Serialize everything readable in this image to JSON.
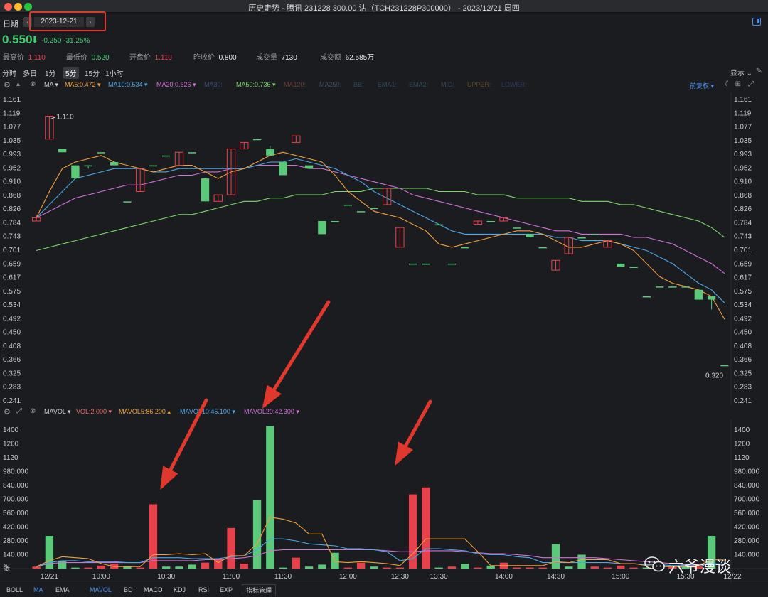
{
  "window": {
    "title": "历史走势 - 腾讯 231228 300.00 沽（TCH231228P300000） - 2023/12/21 周四"
  },
  "datebar": {
    "label": "日期",
    "prev": "‹",
    "date": "2023-12-21",
    "next": "›"
  },
  "quote": {
    "price": "0.550",
    "arrow": "⬇",
    "change": "-0.250 -31.25%"
  },
  "stats": [
    {
      "label": "最高价",
      "value": "1.110",
      "color": "#e8414b"
    },
    {
      "label": "最低价",
      "value": "0.520",
      "color": "#3fcf72"
    },
    {
      "label": "开盘价",
      "value": "1.110",
      "color": "#e8414b"
    },
    {
      "label": "昨收价",
      "value": "0.800",
      "color": "#e6e6e6"
    },
    {
      "label": "成交量",
      "value": "7130",
      "color": "#e6e6e6"
    },
    {
      "label": "成交额",
      "value": "62.585万",
      "color": "#e6e6e6"
    }
  ],
  "periods": [
    "分时",
    "多日",
    "1分",
    "5分",
    "15分",
    "1小时"
  ],
  "active_period": "5分",
  "display": "显示 ⌄",
  "main_indicators": {
    "name": "MA ▾",
    "items": [
      {
        "text": "MA5:0.472 ▾",
        "color": "#f0a03c"
      },
      {
        "text": "MA10:0.534 ▾",
        "color": "#4aa8e8"
      },
      {
        "text": "MA20:0.626 ▾",
        "color": "#d070d8"
      },
      {
        "text": "MA30:",
        "color": "#3a4e70"
      },
      {
        "text": "MA50:0.736 ▾",
        "color": "#7ad86a"
      },
      {
        "text": "MA120:",
        "color": "#6a3a3a"
      },
      {
        "text": "MA250:",
        "color": "#3a5060"
      },
      {
        "text": "BB:",
        "color": "#2e4a5a"
      },
      {
        "text": "EMA1:",
        "color": "#2e4a5a"
      },
      {
        "text": "EMA2:",
        "color": "#2e4a5a"
      },
      {
        "text": "MID:",
        "color": "#3a4a5a"
      },
      {
        "text": "UPPER:",
        "color": "#5a4a2a"
      },
      {
        "text": "LOWER:",
        "color": "#2a3a60"
      }
    ],
    "adjust": "前复权 ▾"
  },
  "vol_indicators": {
    "name": "MAVOL ▾",
    "items": [
      {
        "text": "VOL:2.000 ▾",
        "color": "#e86a6a"
      },
      {
        "text": "MAVOL5:86.200 ▴",
        "color": "#f0a03c"
      },
      {
        "text": "MAVOL10:45.100 ▾",
        "color": "#4aa8e8"
      },
      {
        "text": "MAVOL20:42.300 ▾",
        "color": "#d070d8"
      }
    ]
  },
  "price_axis": [
    "1.161",
    "1.119",
    "1.077",
    "1.035",
    "0.993",
    "0.952",
    "0.910",
    "0.868",
    "0.826",
    "0.784",
    "0.743",
    "0.701",
    "0.659",
    "0.617",
    "0.575",
    "0.534",
    "0.492",
    "0.450",
    "0.408",
    "0.366",
    "0.325",
    "0.283",
    "0.241"
  ],
  "vol_axis": [
    "1400",
    "1260",
    "1120",
    "980.000",
    "840.000",
    "700.000",
    "560.000",
    "420.000",
    "280.000",
    "140.000",
    "张"
  ],
  "vol_axis_right": [
    "1400",
    "1260",
    "1120",
    "980.000",
    "840.000",
    "700.000",
    "560.000",
    "420.000",
    "280.000",
    "140.000"
  ],
  "time_axis": [
    "12/21",
    "10:00",
    "10:30",
    "11:00",
    "11:30",
    "12:00",
    "12:30",
    "13:30",
    "14:00",
    "14:30",
    "15:00",
    "15:30",
    "12/22"
  ],
  "annotations": {
    "high": "1.110",
    "low": "0.320"
  },
  "bottom_tabs": [
    "BOLL",
    "MA",
    "EMA",
    "MAVOL",
    "BD",
    "MACD",
    "KDJ",
    "RSI",
    "EXP",
    "指标管理"
  ],
  "watermark": "六爷漫谈",
  "colors": {
    "up": "#e8414b",
    "down": "#5ac97a",
    "ma5": "#f0a03c",
    "ma10": "#4aa8e8",
    "ma20": "#d070d8",
    "ma50": "#7ad86a",
    "arrow": "#e0382d"
  },
  "chart_data": {
    "type": "candlestick",
    "price_range": [
      0.241,
      1.161
    ],
    "volume_range": [
      0,
      1400
    ],
    "candles": [
      {
        "o": 0.79,
        "h": 0.81,
        "l": 0.79,
        "c": 0.8
      },
      {
        "o": 1.04,
        "h": 1.11,
        "l": 1.04,
        "c": 1.11
      },
      {
        "o": 1.01,
        "h": 1.01,
        "l": 1.0,
        "c": 1.0
      },
      {
        "o": 0.96,
        "h": 0.96,
        "l": 0.92,
        "c": 0.92
      },
      {
        "o": 0.96,
        "h": 0.96,
        "l": 0.95,
        "c": 0.96
      },
      {
        "o": 1.0,
        "h": 1.0,
        "l": 1.0,
        "c": 1.0
      },
      {
        "o": 0.97,
        "h": 0.97,
        "l": 0.96,
        "c": 0.96
      },
      {
        "o": 0.85,
        "h": 0.85,
        "l": 0.85,
        "c": 0.85
      },
      {
        "o": 0.88,
        "h": 0.95,
        "l": 0.88,
        "c": 0.95
      },
      {
        "o": 0.96,
        "h": 0.96,
        "l": 0.96,
        "c": 0.96
      },
      {
        "o": 0.99,
        "h": 0.99,
        "l": 0.99,
        "c": 0.99
      },
      {
        "o": 0.96,
        "h": 1.0,
        "l": 0.96,
        "c": 1.0
      },
      {
        "o": 1.0,
        "h": 1.0,
        "l": 1.0,
        "c": 1.0
      },
      {
        "o": 0.92,
        "h": 0.92,
        "l": 0.85,
        "c": 0.85
      },
      {
        "o": 0.85,
        "h": 0.87,
        "l": 0.85,
        "c": 0.87
      },
      {
        "o": 0.87,
        "h": 1.01,
        "l": 0.87,
        "c": 1.01
      },
      {
        "o": 1.01,
        "h": 1.03,
        "l": 1.01,
        "c": 1.03
      },
      {
        "o": 1.04,
        "h": 1.04,
        "l": 1.04,
        "c": 1.04
      },
      {
        "o": 1.01,
        "h": 1.02,
        "l": 0.99,
        "c": 0.99
      },
      {
        "o": 0.97,
        "h": 0.97,
        "l": 0.93,
        "c": 0.93
      },
      {
        "o": 1.03,
        "h": 1.05,
        "l": 1.03,
        "c": 1.05
      },
      {
        "o": 0.96,
        "h": 0.96,
        "l": 0.95,
        "c": 0.95
      },
      {
        "o": 0.79,
        "h": 0.79,
        "l": 0.75,
        "c": 0.75
      },
      {
        "o": 0.79,
        "h": 0.79,
        "l": 0.79,
        "c": 0.79
      },
      {
        "o": 0.84,
        "h": 0.84,
        "l": 0.84,
        "c": 0.84
      },
      {
        "o": 0.82,
        "h": 0.82,
        "l": 0.82,
        "c": 0.82
      },
      {
        "o": 0.83,
        "h": 0.83,
        "l": 0.83,
        "c": 0.83
      },
      {
        "o": 0.84,
        "h": 0.89,
        "l": 0.84,
        "c": 0.89
      },
      {
        "o": 0.71,
        "h": 0.77,
        "l": 0.71,
        "c": 0.77
      },
      {
        "o": 0.66,
        "h": 0.66,
        "l": 0.66,
        "c": 0.66
      },
      {
        "o": 0.66,
        "h": 0.66,
        "l": 0.66,
        "c": 0.66
      },
      {
        "o": 0.78,
        "h": 0.78,
        "l": 0.78,
        "c": 0.78
      },
      {
        "o": 0.66,
        "h": 0.66,
        "l": 0.66,
        "c": 0.66
      },
      {
        "o": 0.71,
        "h": 0.71,
        "l": 0.71,
        "c": 0.71
      },
      {
        "o": 0.78,
        "h": 0.79,
        "l": 0.78,
        "c": 0.79
      },
      {
        "o": 0.79,
        "h": 0.79,
        "l": 0.79,
        "c": 0.79
      },
      {
        "o": 0.79,
        "h": 0.8,
        "l": 0.79,
        "c": 0.8
      },
      {
        "o": 0.77,
        "h": 0.77,
        "l": 0.77,
        "c": 0.77
      },
      {
        "o": 0.75,
        "h": 0.75,
        "l": 0.74,
        "c": 0.74
      },
      {
        "o": 0.71,
        "h": 0.71,
        "l": 0.71,
        "c": 0.71
      },
      {
        "o": 0.64,
        "h": 0.67,
        "l": 0.64,
        "c": 0.67
      },
      {
        "o": 0.69,
        "h": 0.74,
        "l": 0.69,
        "c": 0.74
      },
      {
        "o": 0.74,
        "h": 0.74,
        "l": 0.74,
        "c": 0.74
      },
      {
        "o": 0.75,
        "h": 0.75,
        "l": 0.75,
        "c": 0.75
      },
      {
        "o": 0.71,
        "h": 0.73,
        "l": 0.71,
        "c": 0.73
      },
      {
        "o": 0.66,
        "h": 0.66,
        "l": 0.65,
        "c": 0.65
      },
      {
        "o": 0.65,
        "h": 0.65,
        "l": 0.65,
        "c": 0.65
      },
      {
        "o": 0.56,
        "h": 0.56,
        "l": 0.56,
        "c": 0.56
      },
      {
        "o": 0.59,
        "h": 0.59,
        "l": 0.59,
        "c": 0.59
      },
      {
        "o": 0.59,
        "h": 0.59,
        "l": 0.59,
        "c": 0.59
      },
      {
        "o": 0.59,
        "h": 0.59,
        "l": 0.59,
        "c": 0.59
      },
      {
        "o": 0.58,
        "h": 0.58,
        "l": 0.55,
        "c": 0.55
      },
      {
        "o": 0.56,
        "h": 0.56,
        "l": 0.52,
        "c": 0.55
      },
      {
        "o": 0.35,
        "h": 0.35,
        "l": 0.35,
        "c": 0.35
      }
    ],
    "volumes": [
      {
        "v": 20,
        "up": true
      },
      {
        "v": 330,
        "up": false
      },
      {
        "v": 80,
        "up": false
      },
      {
        "v": 10,
        "up": false
      },
      {
        "v": 10,
        "up": true
      },
      {
        "v": 30,
        "up": true
      },
      {
        "v": 50,
        "up": true
      },
      {
        "v": 20,
        "up": false
      },
      {
        "v": 10,
        "up": true
      },
      {
        "v": 650,
        "up": true
      },
      {
        "v": 20,
        "up": false
      },
      {
        "v": 20,
        "up": false
      },
      {
        "v": 40,
        "up": false
      },
      {
        "v": 60,
        "up": true
      },
      {
        "v": 100,
        "up": true
      },
      {
        "v": 410,
        "up": true
      },
      {
        "v": 50,
        "up": true
      },
      {
        "v": 690,
        "up": false
      },
      {
        "v": 1440,
        "up": false
      },
      {
        "v": 10,
        "up": false
      },
      {
        "v": 110,
        "up": true
      },
      {
        "v": 20,
        "up": false
      },
      {
        "v": 40,
        "up": false
      },
      {
        "v": 160,
        "up": false
      },
      {
        "v": 10,
        "up": true
      },
      {
        "v": 60,
        "up": true
      },
      {
        "v": 20,
        "up": false
      },
      {
        "v": 10,
        "up": true
      },
      {
        "v": 10,
        "up": true
      },
      {
        "v": 750,
        "up": true
      },
      {
        "v": 820,
        "up": true
      },
      {
        "v": 10,
        "up": false
      },
      {
        "v": 20,
        "up": true
      },
      {
        "v": 50,
        "up": false
      },
      {
        "v": 10,
        "up": true
      },
      {
        "v": 30,
        "up": false
      },
      {
        "v": 60,
        "up": true
      },
      {
        "v": 10,
        "up": true
      },
      {
        "v": 10,
        "up": true
      },
      {
        "v": 10,
        "up": true
      },
      {
        "v": 250,
        "up": false
      },
      {
        "v": 20,
        "up": false
      },
      {
        "v": 140,
        "up": false
      },
      {
        "v": 20,
        "up": true
      },
      {
        "v": 10,
        "up": true
      },
      {
        "v": 30,
        "up": true
      },
      {
        "v": 10,
        "up": true
      },
      {
        "v": 10,
        "up": false
      },
      {
        "v": 10,
        "up": true
      },
      {
        "v": 20,
        "up": true
      },
      {
        "v": 40,
        "up": false
      },
      {
        "v": 20,
        "up": true
      },
      {
        "v": 330,
        "up": false
      }
    ],
    "ma5": [
      0.8,
      0.88,
      0.95,
      0.97,
      0.98,
      0.99,
      0.97,
      0.96,
      0.95,
      0.94,
      0.95,
      0.96,
      0.96,
      0.94,
      0.92,
      0.94,
      0.95,
      0.97,
      0.99,
      1.0,
      0.99,
      0.98,
      0.97,
      0.93,
      0.88,
      0.85,
      0.82,
      0.81,
      0.8,
      0.78,
      0.76,
      0.72,
      0.71,
      0.72,
      0.73,
      0.74,
      0.75,
      0.76,
      0.76,
      0.75,
      0.73,
      0.71,
      0.71,
      0.72,
      0.73,
      0.72,
      0.7,
      0.66,
      0.62,
      0.6,
      0.59,
      0.58,
      0.56,
      0.49
    ],
    "ma10": [
      0.8,
      0.84,
      0.88,
      0.92,
      0.93,
      0.94,
      0.95,
      0.95,
      0.95,
      0.94,
      0.94,
      0.95,
      0.95,
      0.95,
      0.95,
      0.95,
      0.95,
      0.96,
      0.97,
      0.97,
      0.98,
      0.97,
      0.96,
      0.95,
      0.93,
      0.91,
      0.88,
      0.86,
      0.84,
      0.82,
      0.8,
      0.78,
      0.76,
      0.75,
      0.75,
      0.75,
      0.75,
      0.75,
      0.75,
      0.75,
      0.74,
      0.74,
      0.73,
      0.73,
      0.73,
      0.72,
      0.71,
      0.7,
      0.68,
      0.66,
      0.63,
      0.6,
      0.58,
      0.54
    ],
    "ma20": [
      0.8,
      0.82,
      0.84,
      0.86,
      0.87,
      0.88,
      0.89,
      0.9,
      0.9,
      0.91,
      0.92,
      0.93,
      0.93,
      0.94,
      0.94,
      0.95,
      0.95,
      0.96,
      0.96,
      0.96,
      0.96,
      0.95,
      0.95,
      0.94,
      0.93,
      0.92,
      0.91,
      0.9,
      0.89,
      0.87,
      0.86,
      0.85,
      0.84,
      0.83,
      0.82,
      0.81,
      0.8,
      0.79,
      0.78,
      0.77,
      0.76,
      0.76,
      0.75,
      0.75,
      0.75,
      0.75,
      0.74,
      0.74,
      0.73,
      0.72,
      0.7,
      0.68,
      0.66,
      0.63
    ],
    "ma50": [
      0.7,
      0.71,
      0.72,
      0.73,
      0.74,
      0.75,
      0.76,
      0.77,
      0.78,
      0.79,
      0.8,
      0.81,
      0.81,
      0.82,
      0.83,
      0.84,
      0.85,
      0.85,
      0.86,
      0.86,
      0.87,
      0.87,
      0.87,
      0.88,
      0.88,
      0.88,
      0.89,
      0.89,
      0.89,
      0.89,
      0.89,
      0.88,
      0.88,
      0.88,
      0.87,
      0.87,
      0.87,
      0.86,
      0.86,
      0.86,
      0.86,
      0.86,
      0.85,
      0.85,
      0.85,
      0.84,
      0.84,
      0.83,
      0.82,
      0.81,
      0.8,
      0.79,
      0.77,
      0.74
    ],
    "mavol5": [
      20,
      80,
      120,
      110,
      100,
      50,
      20,
      20,
      20,
      140,
      140,
      150,
      140,
      150,
      60,
      130,
      130,
      250,
      520,
      500,
      460,
      350,
      350,
      70,
      60,
      70,
      60,
      50,
      30,
      150,
      300,
      300,
      300,
      300,
      170,
      30,
      30,
      30,
      30,
      30,
      70,
      60,
      90,
      90,
      90,
      50,
      50,
      30,
      20,
      20,
      20,
      30,
      90,
      86
    ],
    "mavol10": [
      20,
      60,
      80,
      80,
      70,
      70,
      70,
      60,
      60,
      110,
      110,
      110,
      100,
      100,
      100,
      120,
      130,
      190,
      300,
      300,
      280,
      250,
      240,
      230,
      200,
      200,
      190,
      170,
      80,
      100,
      200,
      200,
      190,
      180,
      150,
      140,
      140,
      120,
      110,
      60,
      60,
      60,
      60,
      60,
      60,
      50,
      50,
      40,
      40,
      30,
      30,
      30,
      50,
      45
    ],
    "mavol20": [
      20,
      50,
      60,
      60,
      60,
      60,
      60,
      60,
      60,
      80,
      80,
      80,
      80,
      90,
      90,
      100,
      110,
      130,
      180,
      190,
      190,
      190,
      190,
      190,
      190,
      190,
      190,
      180,
      170,
      170,
      180,
      180,
      180,
      170,
      160,
      150,
      150,
      140,
      130,
      110,
      110,
      110,
      110,
      110,
      100,
      90,
      80,
      70,
      60,
      50,
      40,
      40,
      40,
      42
    ]
  }
}
